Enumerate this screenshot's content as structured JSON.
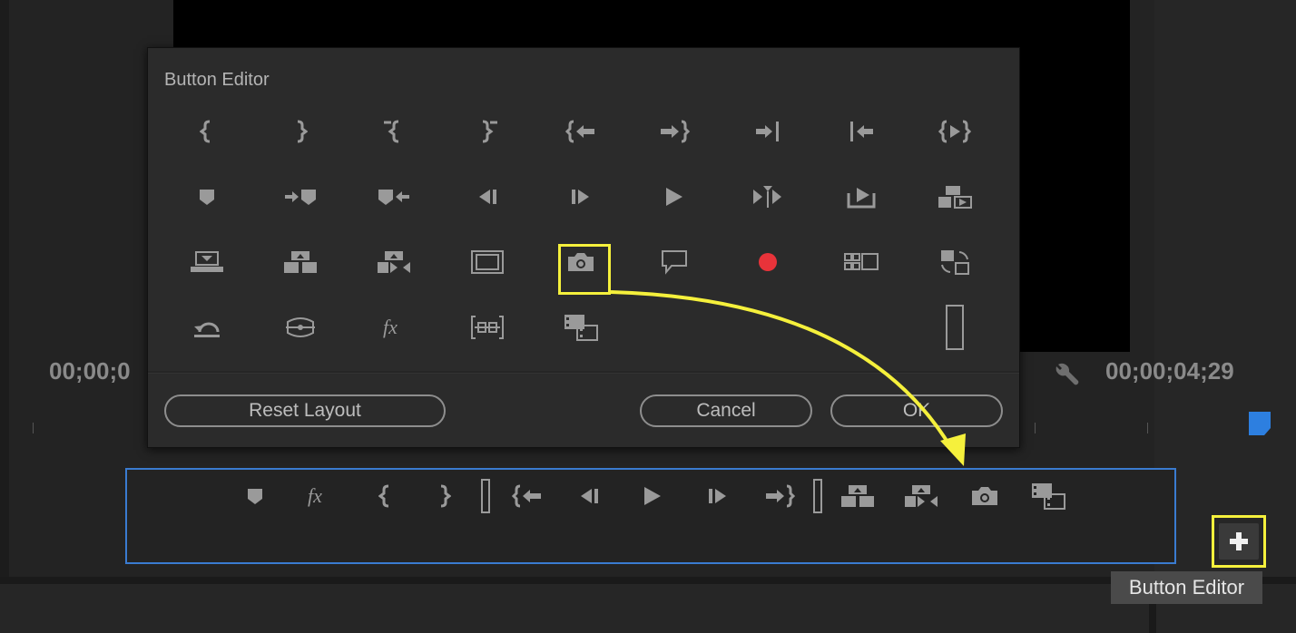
{
  "timecode": {
    "left": "00;00;0",
    "right": "00;00;04;29"
  },
  "dialog": {
    "title": "Button Editor",
    "buttons": {
      "reset": "Reset Layout",
      "cancel": "Cancel",
      "ok": "OK"
    },
    "icons": [
      [
        "mark-in-icon",
        "mark-out-icon",
        "clear-in-icon",
        "clear-out-icon",
        "go-to-in-icon",
        "go-to-out-icon",
        "go-to-next-edit-icon",
        "go-to-previous-edit-icon",
        "play-in-to-out-icon"
      ],
      [
        "add-marker-icon",
        "go-to-next-marker-icon",
        "go-to-previous-marker-icon",
        "step-back-icon",
        "step-forward-icon",
        "play-icon",
        "play-around-icon",
        "export-frame-icon",
        "overwrite-icon"
      ],
      [
        "lift-icon",
        "insert-icon",
        "overlay-icon",
        "safe-margins-icon",
        "camera-icon",
        "comment-icon",
        "record-icon",
        "multi-camera-icon",
        "toggle-proxies-icon"
      ],
      [
        "loop-icon",
        "vr-video-icon",
        "fx-icon",
        "trim-icon",
        "insert-clip-icon",
        "",
        "",
        "",
        "spacer-icon"
      ]
    ]
  },
  "toolbar": {
    "icons": [
      "add-marker-icon",
      "fx-icon",
      "mark-in-icon",
      "mark-out-icon",
      "spacer-icon",
      "go-to-in-icon",
      "step-back-icon",
      "play-icon",
      "step-forward-icon",
      "go-to-out-icon",
      "spacer-icon",
      "insert-icon",
      "overlay-icon",
      "camera-icon",
      "insert-clip-icon"
    ]
  },
  "tooltip": "Button Editor",
  "colors": {
    "highlight": "#f5f03c",
    "toolbar_border": "#3a7bd0",
    "record": "#e8333a",
    "marker": "#2d7fe0"
  }
}
